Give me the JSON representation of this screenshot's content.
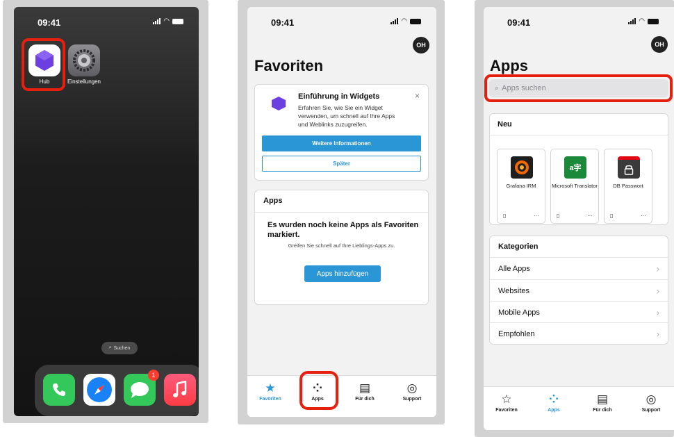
{
  "home": {
    "time": "09:41",
    "apps": [
      {
        "label": "Hub",
        "icon": "hexagon-icon"
      },
      {
        "label": "Einstellungen",
        "icon": "gear-icon"
      }
    ],
    "search_label": "Suchen",
    "dock": [
      {
        "name": "phone-app",
        "icon": "phone-icon",
        "color": "#34c759"
      },
      {
        "name": "safari-app",
        "icon": "compass-icon",
        "color": "#1a82f7"
      },
      {
        "name": "messages-app",
        "icon": "chat-bubble-icon",
        "color": "#34c759",
        "badge": "1"
      },
      {
        "name": "music-app",
        "icon": "music-note-icon",
        "color": "#fc3c44"
      }
    ]
  },
  "favorites": {
    "time": "09:41",
    "avatar": "OH",
    "title": "Favoriten",
    "widget_card": {
      "title": "Einführung in Widgets",
      "body": "Erfahren Sie, wie Sie ein Widget verwenden, um schnell auf Ihre Apps und Weblinks zuzugreifen.",
      "primary": "Weitere Informationen",
      "secondary": "Später"
    },
    "apps_card": {
      "header": "Apps",
      "empty_title": "Es wurden noch keine Apps als Favoriten markiert.",
      "empty_body": "Greifen Sie schnell auf Ihre Lieblings-Apps zu.",
      "button": "Apps hinzufügen"
    }
  },
  "apps": {
    "time": "09:41",
    "avatar": "OH",
    "title": "Apps",
    "search_placeholder": "Apps suchen",
    "new_header": "Neu",
    "new_apps": [
      {
        "label": "Grafana IRM",
        "icon": "grafana-icon",
        "color": "#1f1f1f"
      },
      {
        "label": "Microsoft Translator",
        "icon": "translator-icon",
        "color": "#1a8a3a"
      },
      {
        "label": "DB Passwort",
        "icon": "lock-icon",
        "color": "#3a3a3a"
      }
    ],
    "categories_header": "Kategorien",
    "categories": [
      "Alle Apps",
      "Websites",
      "Mobile Apps",
      "Empfohlen"
    ]
  },
  "tabs": [
    "Favoriten",
    "Apps",
    "Für dich",
    "Support"
  ],
  "accent": "#2a96d6",
  "highlight": "#e5200e"
}
